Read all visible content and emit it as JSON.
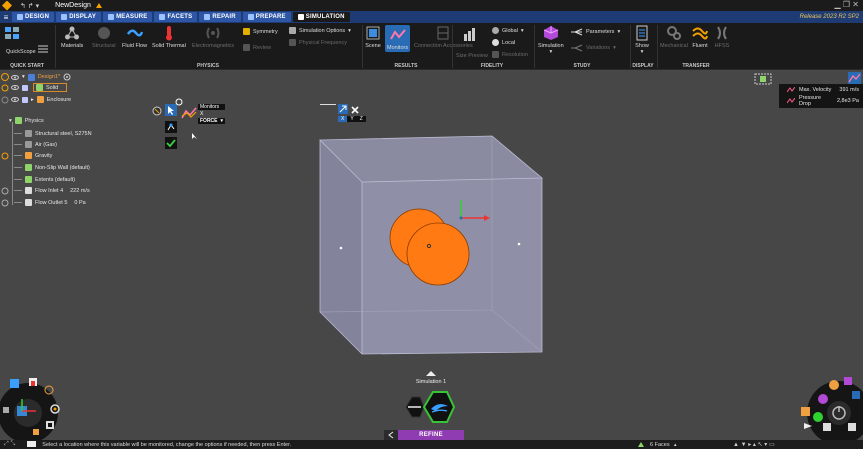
{
  "window": {
    "quick_access": "↰  ↱  ▾",
    "document_title": "NewDesign",
    "release": "Release 2023 R2 SP2",
    "controls": "▁  ❐  ✕"
  },
  "tabs": [
    {
      "label": "Design",
      "active": false
    },
    {
      "label": "Display",
      "active": false
    },
    {
      "label": "Measure",
      "active": false
    },
    {
      "label": "Facets",
      "active": false
    },
    {
      "label": "Repair",
      "active": false
    },
    {
      "label": "Prepare",
      "active": false
    },
    {
      "label": "Simulation",
      "active": true
    }
  ],
  "ribbon": {
    "quickscope": "QuickScope",
    "materials": "Materials",
    "structural": "Structural",
    "fluid_flow": "Fluid Flow",
    "solid_thermal": "Solid Thermal",
    "electromagnetics": "Electromagnetics",
    "symmetry": "Symmetry",
    "review": "Review",
    "simulation_options": "Simulation Options",
    "physical_frequency": "Physical Frequency",
    "scene": "Scene",
    "monitors": "Monitors",
    "connection_accessories": "Connection Accessories",
    "size_preview": "Size Preview",
    "global": "Global",
    "local": "Local",
    "resolution": "Resolution",
    "simulation": "Simulation",
    "parameters": "Parameters",
    "variations": "Variations",
    "show": "Show",
    "mechanical": "Mechanical",
    "fluent": "Fluent",
    "hfss": "HFSS",
    "groups": {
      "quick_start": "Quick Start",
      "physics": "Physics",
      "results": "Results",
      "fidelity": "Fidelity",
      "study": "Study",
      "display": "Display",
      "transfer": "Transfer"
    }
  },
  "tree": {
    "design": "Design1*",
    "solid": "Solid",
    "enclosure": "Enclosure",
    "physics": "Physics",
    "structural_steel": "Structural steel, S275N",
    "air": "Air (Gas)",
    "gravity": "Gravity",
    "non_slip_wall": "Non-Slip Wall (default)",
    "extents": "Extents (default)",
    "flow_inlet": "Flow Inlet 4",
    "flow_inlet_value": "222 m/s",
    "flow_outlet": "Flow Outlet 5",
    "flow_outlet_value": "0 Pa"
  },
  "monitor_tool": {
    "title": "Monitors",
    "axis_label": "X",
    "dropdown": "Force"
  },
  "axis_widget": {
    "x": "X",
    "y": "Y",
    "z": "Z"
  },
  "legend": [
    {
      "label": "Max. Velocity",
      "value": "391 m/s",
      "color": "#ff5c8a"
    },
    {
      "label": "Pressure Drop",
      "value": "2,8e3 Pa",
      "color": "#ff5c8a"
    }
  ],
  "viewport": {
    "simulation_label": "Simulation 1",
    "refine_label": "Refine",
    "box_color": "#8e8ea6",
    "sphere_color": "#ff7a12"
  },
  "statusbar": {
    "message": "Select a location where this variable will be monitored, change the options if needed, then press Enter.",
    "faces": "6 Faces"
  }
}
